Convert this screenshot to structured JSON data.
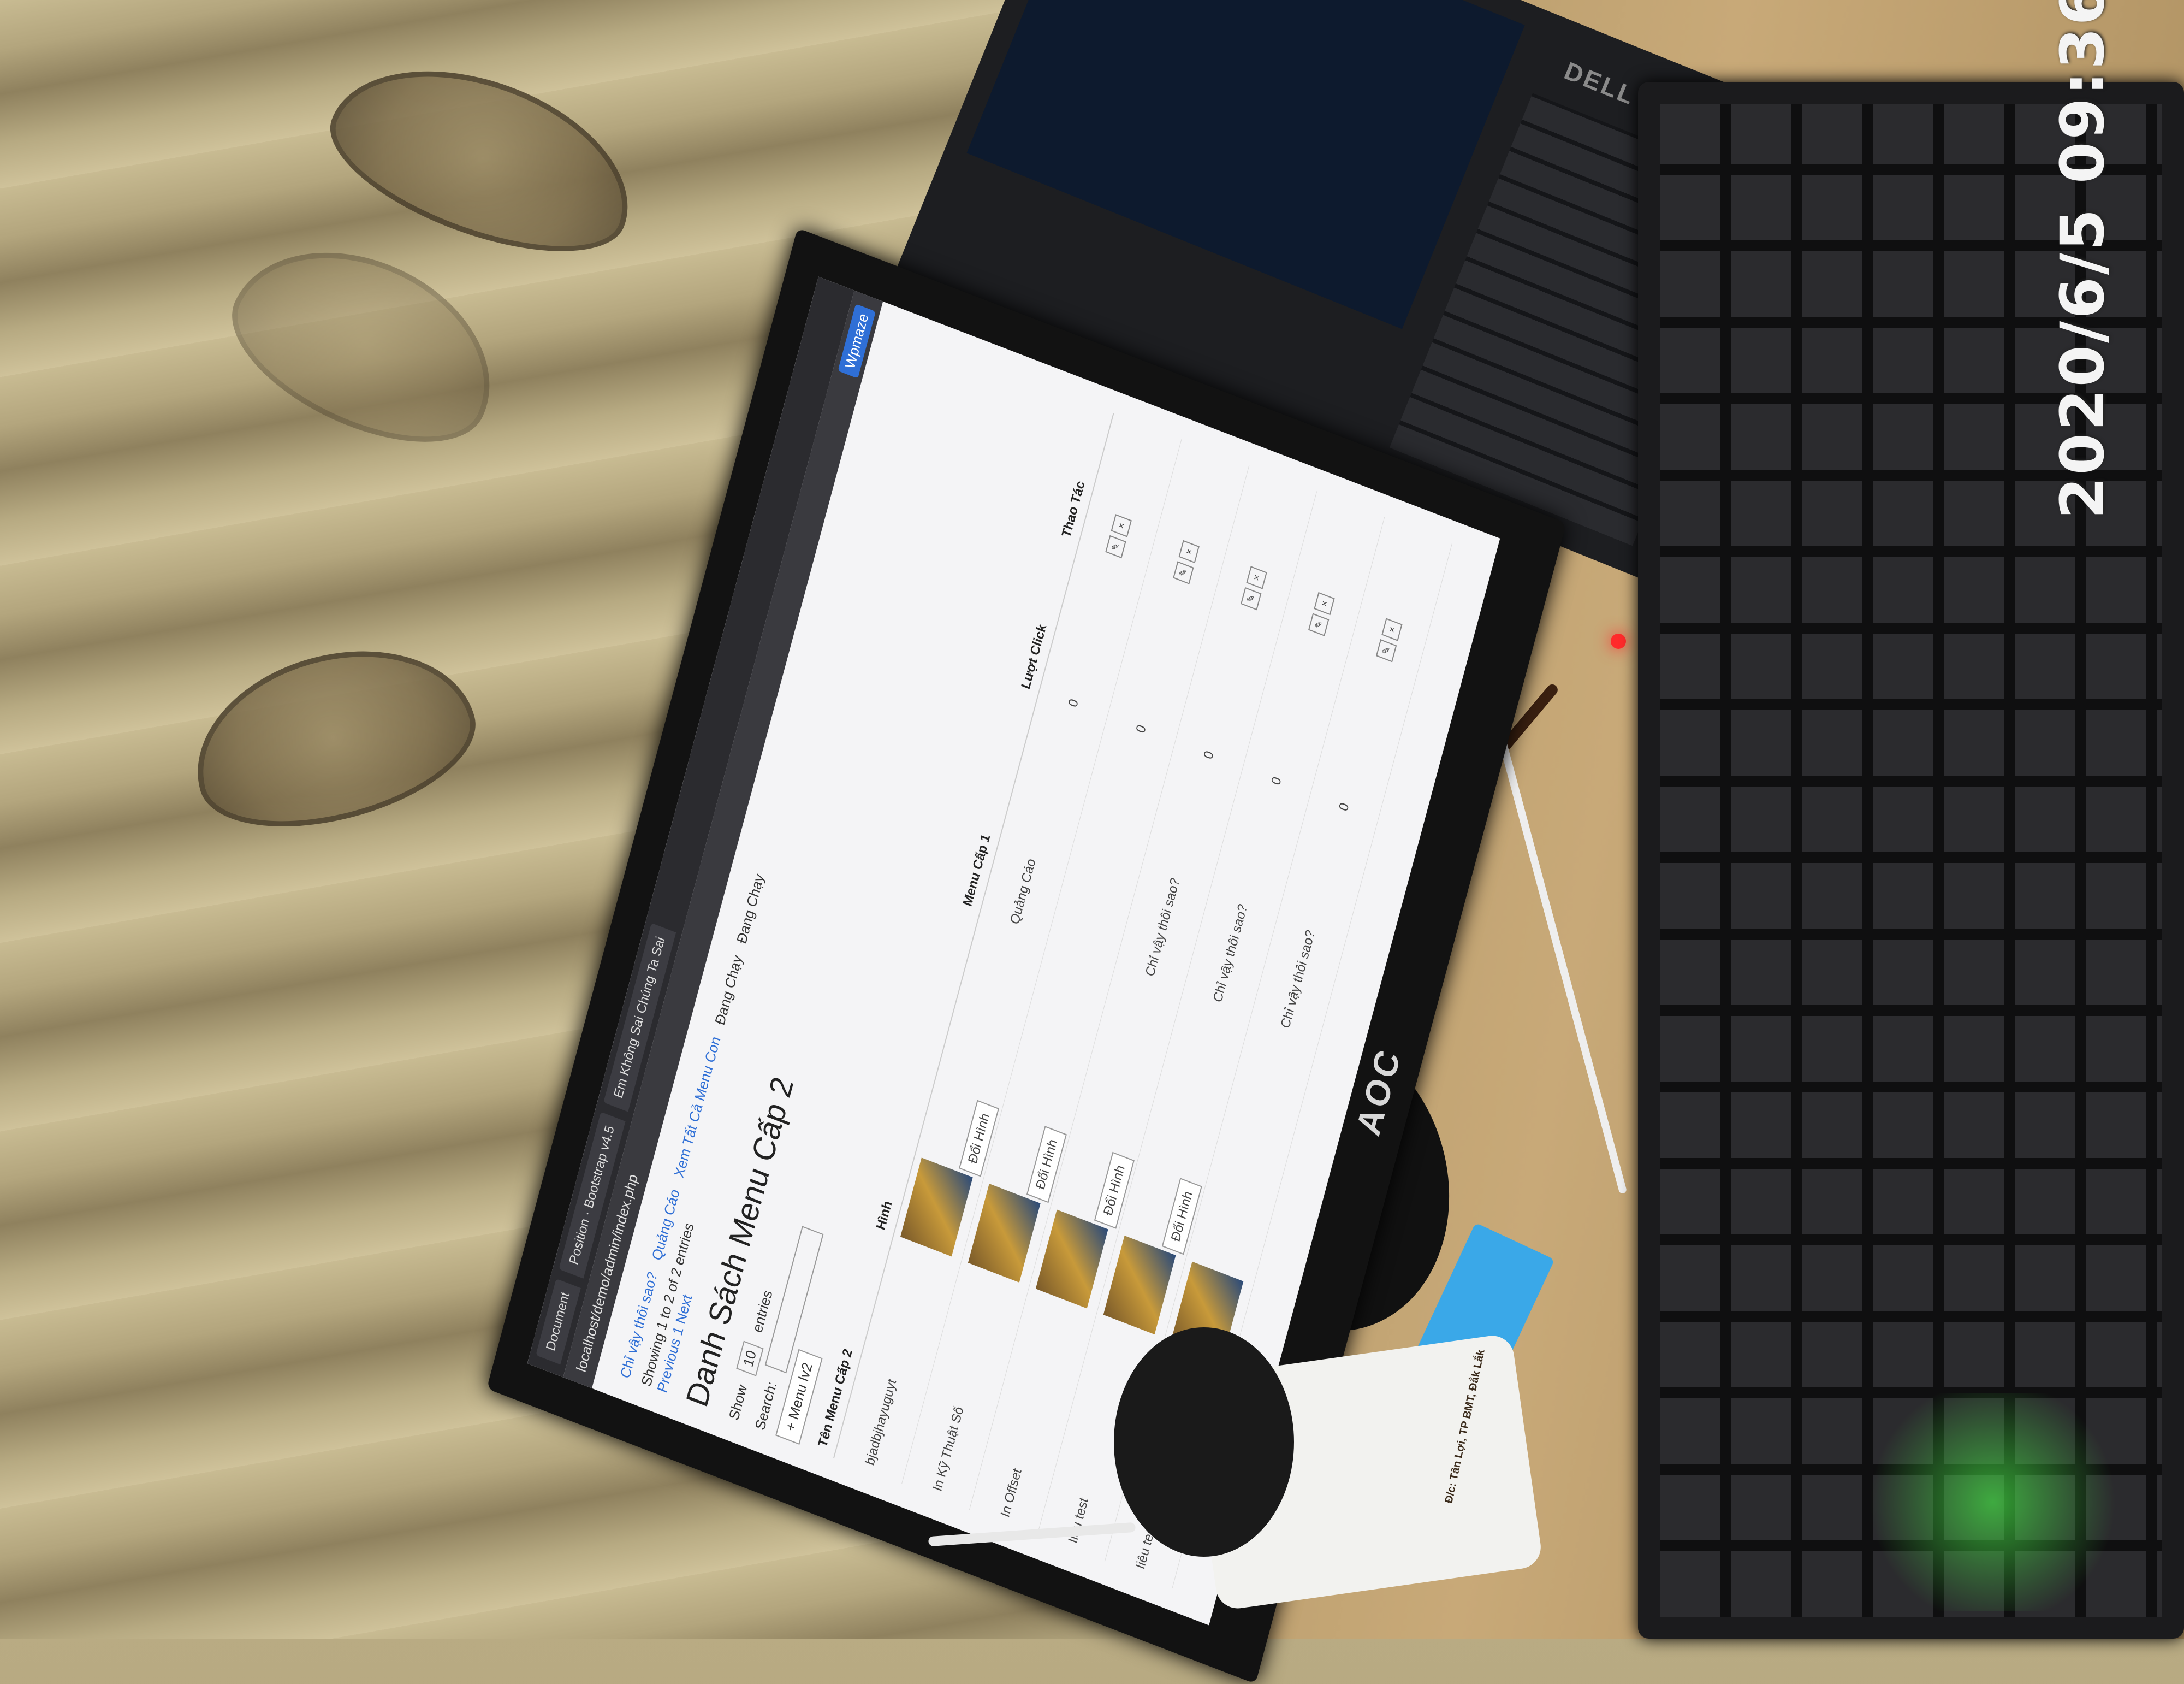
{
  "timestamp_overlay": "2020/6/5 09:36",
  "monitor": {
    "brand": "AOC",
    "browser": {
      "tabs": [
        "Document",
        "Position · Bootstrap v4.5",
        "Em Không Sai Chúng Ta Sai"
      ],
      "url": "localhost/demo/admin/index.php",
      "extension_label": "Wpmaze"
    },
    "page": {
      "top_links": [
        "Chỉ vậy thôi sao?",
        "Quảng Cáo",
        "Xem Tất Cả Menu Con"
      ],
      "status_labels": [
        "Đang Chạy",
        "Đang Chạy"
      ],
      "info": "Showing 1 to 2 of 2 entries",
      "pagination": "Previous 1 Next",
      "title": "Danh Sách Menu Cấp 2",
      "show_label": "Show",
      "show_value": "10",
      "entries_label": "entries",
      "search_label": "Search:",
      "add_button": "+ Menu lv2",
      "columns": [
        "Tên Menu Cấp 2",
        "Hình",
        "Menu Cấp 1",
        "Lượt Click",
        "Thao Tác"
      ],
      "rows": [
        {
          "name": "bjadbjhayuguyt",
          "image_button": "Đổi Hình",
          "menu1": "Quảng Cáo",
          "clicks": "0"
        },
        {
          "name": "In Kỹ Thuật Số",
          "image_button": "Đổi Hình",
          "menu1": "",
          "clicks": "0"
        },
        {
          "name": "In Offset",
          "image_button": "Đổi Hình",
          "menu1": "Chỉ vậy thôi sao?",
          "clicks": "0"
        },
        {
          "name": "Iiêu test",
          "image_button": "Đổi Hình",
          "menu1": "Chỉ vậy thôi sao?",
          "clicks": "0"
        },
        {
          "name": "Iiêu test",
          "image_button": "",
          "menu1": "Chỉ vậy thôi sao?",
          "clicks": "0"
        }
      ]
    }
  },
  "laptop": {
    "brand": "DELL"
  },
  "cup": {
    "text": "Đ/c: Tân Lợi, TP BMT, Đắk Lắk"
  }
}
